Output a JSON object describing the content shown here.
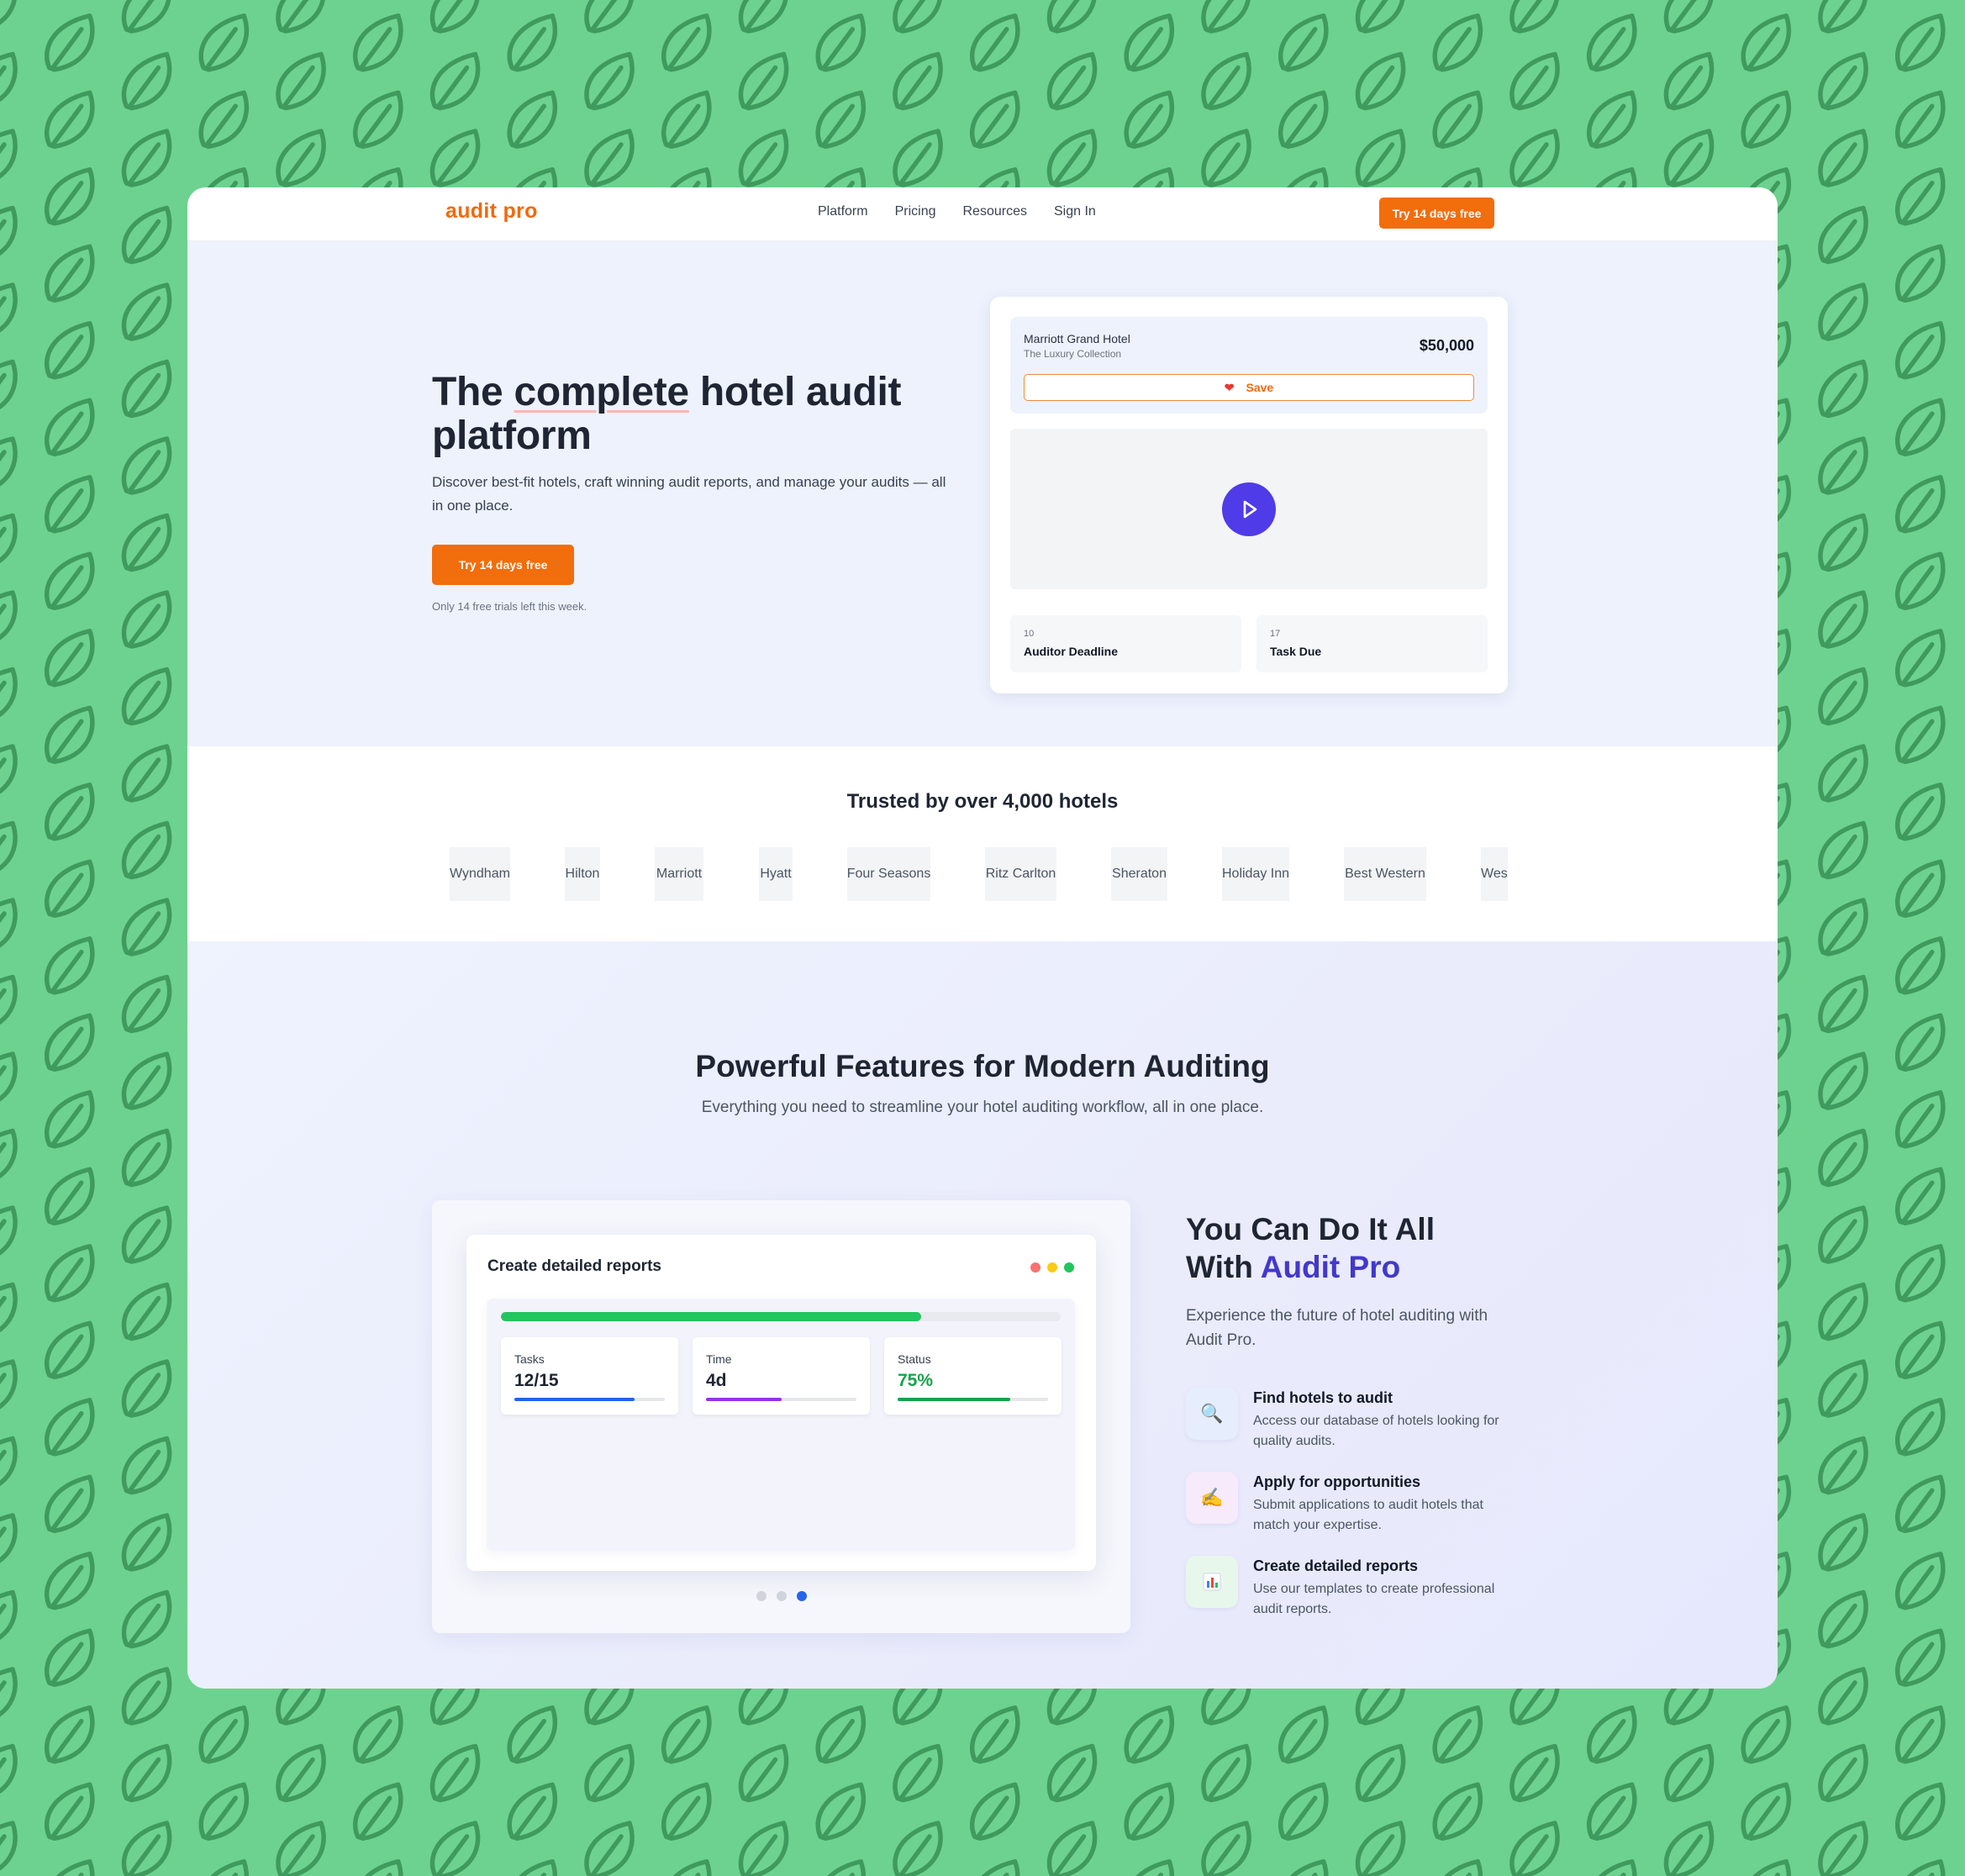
{
  "nav": {
    "logo": "audit pro",
    "links": [
      "Platform",
      "Pricing",
      "Resources",
      "Sign In"
    ],
    "cta": "Try 14 days free"
  },
  "hero": {
    "title_pre": "The ",
    "title_underlined": "complete",
    "title_post": " hotel audit platform",
    "subtitle": "Discover best-fit hotels, craft winning audit reports, and manage your audits — all in one place.",
    "cta": "Try 14 days free",
    "note": "Only 14 free trials left this week."
  },
  "listing_card": {
    "hotel_name": "Marriott Grand Hotel",
    "collection": "The Luxury Collection",
    "price": "$50,000",
    "save_label": "Save",
    "stats": [
      {
        "number": "10",
        "label": "Auditor Deadline"
      },
      {
        "number": "17",
        "label": "Task Due"
      }
    ]
  },
  "trusted": {
    "title": "Trusted by over 4,000 hotels",
    "logos": [
      "Wyndham",
      "Hilton",
      "Marriott",
      "Hyatt",
      "Four Seasons",
      "Ritz Carlton",
      "Sheraton",
      "Holiday Inn",
      "Best Western",
      "Westin"
    ]
  },
  "features": {
    "title": "Powerful Features for Modern Auditing",
    "subtitle": "Everything you need to streamline your hotel auditing workflow, all in one place.",
    "demo": {
      "window_title": "Create detailed reports",
      "progress": 0.75,
      "stats": [
        {
          "label": "Tasks",
          "value": "12/15",
          "fill": 0.8,
          "color": "#2563eb",
          "value_color": "#1f2533"
        },
        {
          "label": "Time",
          "value": "4d",
          "fill": 0.5,
          "color": "#9333ea",
          "value_color": "#1f2533"
        },
        {
          "label": "Status",
          "value": "75%",
          "fill": 0.75,
          "color": "#16a34a",
          "value_color": "#16a34a"
        }
      ],
      "active_slide": 3,
      "slide_count": 3
    },
    "side_title_line1": "You Can Do It All",
    "side_title_pre": "With ",
    "side_title_accent": "Audit Pro",
    "side_subtitle": "Experience the future of hotel auditing with Audit Pro.",
    "items": [
      {
        "icon": "magnifier-icon",
        "title": "Find hotels to audit",
        "description": "Access our database of hotels looking for quality audits."
      },
      {
        "icon": "writing-hand-icon",
        "title": "Apply for opportunities",
        "description": "Submit applications to audit hotels that match your expertise."
      },
      {
        "icon": "bar-chart-icon",
        "title": "Create detailed reports",
        "description": "Use our templates to create professional audit reports."
      }
    ]
  },
  "colors": {
    "background": "#6dd28f",
    "pattern": "#3f9a5e",
    "brand_orange": "#f26d0c",
    "accent_blue": "#4338ca",
    "play_button": "#4f3be8"
  }
}
